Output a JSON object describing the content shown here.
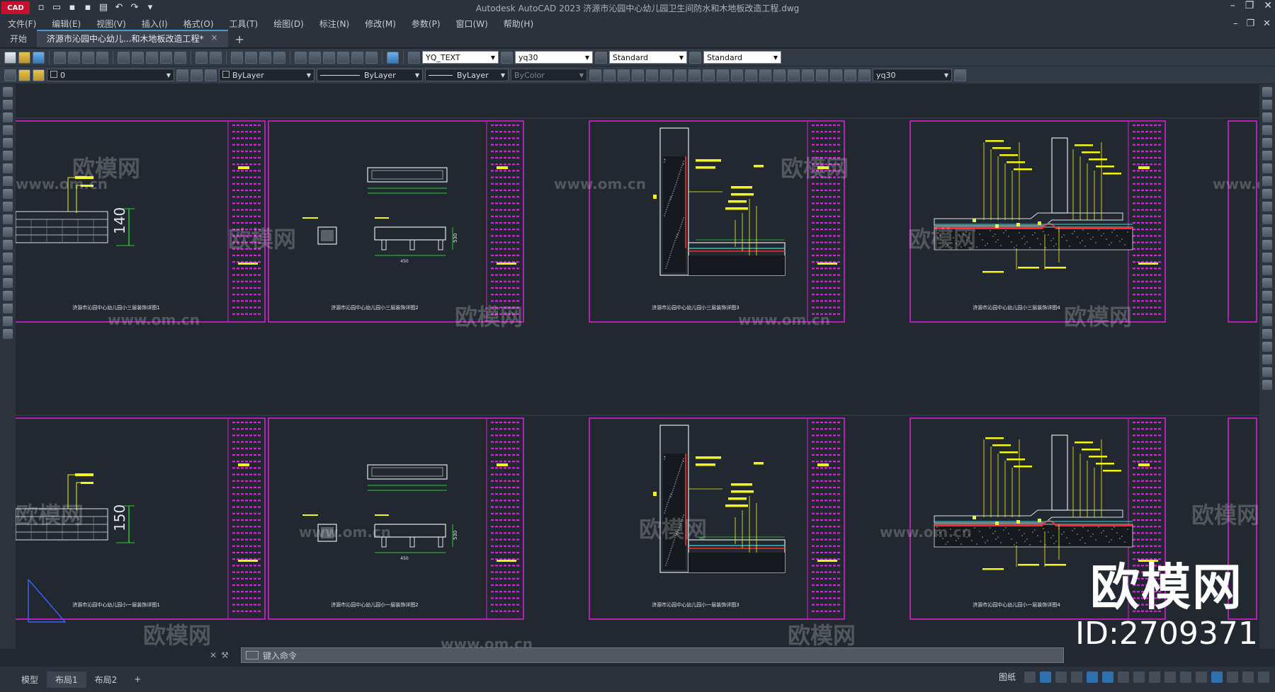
{
  "app": {
    "badge": "CAD",
    "title": "Autodesk AutoCAD 2023    济源市沁园中心幼儿园卫生间防水和木地板改造工程.dwg"
  },
  "menu": [
    "文件(F)",
    "编辑(E)",
    "视图(V)",
    "插入(I)",
    "格式(O)",
    "工具(T)",
    "绘图(D)",
    "标注(N)",
    "修改(M)",
    "参数(P)",
    "窗口(W)",
    "帮助(H)"
  ],
  "tabs": {
    "start": "开始",
    "doc": "济源市沁园中心幼儿...和木地板改造工程*",
    "close": "×",
    "new": "+"
  },
  "toolbar1": {
    "text_style": "YQ_TEXT",
    "dim_style": "yq30",
    "table_style": "Standard",
    "mleader_style": "Standard"
  },
  "toolbar2": {
    "layer": "0",
    "color": "ByLayer",
    "linetype": "ByLayer",
    "lineweight": "ByLayer",
    "plotstyle": "ByColor",
    "dim_style": "yq30"
  },
  "command": {
    "placeholder": "键入命令",
    "handle": "✕ 🔧"
  },
  "layout_tabs": [
    "模型",
    "布局1",
    "布局2"
  ],
  "layout_add": "+",
  "status": {
    "paper_label": "图纸"
  },
  "watermark": {
    "url": "www.om.cn",
    "brand": "欧模网",
    "id": "ID:2709371"
  },
  "drawings": {
    "row1": [
      {
        "title": "济源市沁园中心幼儿园小三层装饰详图1",
        "dim": "140"
      },
      {
        "title": "济源市沁园中心幼儿园小三层装饰详图2",
        "dims": [
          "530",
          "450"
        ]
      },
      {
        "title": "济源市沁园中心幼儿园小三层装饰详图3"
      },
      {
        "title": "济源市沁园中心幼儿园小三层装饰详图4"
      }
    ],
    "row2": [
      {
        "title": "济源市沁园中心幼儿园小一层装饰详图1",
        "dim": "150"
      },
      {
        "title": "济源市沁园中心幼儿园小一层装饰详图2",
        "dims": [
          "530",
          "450"
        ]
      },
      {
        "title": "济源市沁园中心幼儿园小一层装饰详图3"
      },
      {
        "title": "济源市沁园中心幼儿园小一层装饰详图4"
      }
    ]
  }
}
